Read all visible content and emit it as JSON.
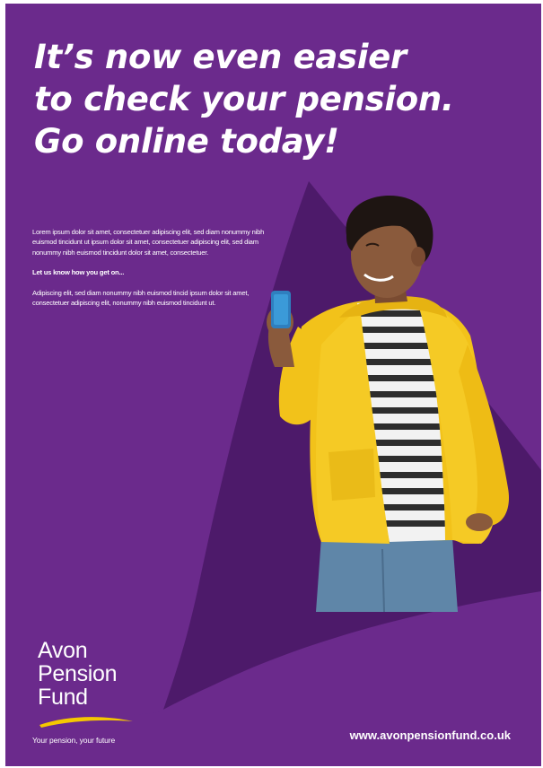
{
  "headline": {
    "line1": "It’s now even easier",
    "line2": "to check your pension.",
    "line3": "Go online today!"
  },
  "body": {
    "paragraph1": "Lorem ipsum dolor sit amet, consectetuer adipiscing elit, sed diam nonummy nibh euismod tincidunt ut ipsum dolor sit amet, consectetuer adipiscing elit, sed diam nonummy nibh euismod tincidunt dolor sit amet, consectetuer.",
    "cta": "Let us know how you get on...",
    "paragraph2": "Adipiscing elit, sed diam nonummy nibh euismod tincid ipsum dolor sit amet, consectetuer adipiscing elit, nonummy nibh euismod tincidunt ut."
  },
  "logo": {
    "line1": "Avon",
    "line2": "Pension",
    "line3": "Fund"
  },
  "tagline": "Your pension, your future",
  "url": "www.avonpensionfund.co.uk",
  "colors": {
    "background": "#6b2a8c",
    "accent_dark": "#4d1a6a",
    "jacket": "#f2c21a",
    "swoosh": "#f5c800"
  }
}
